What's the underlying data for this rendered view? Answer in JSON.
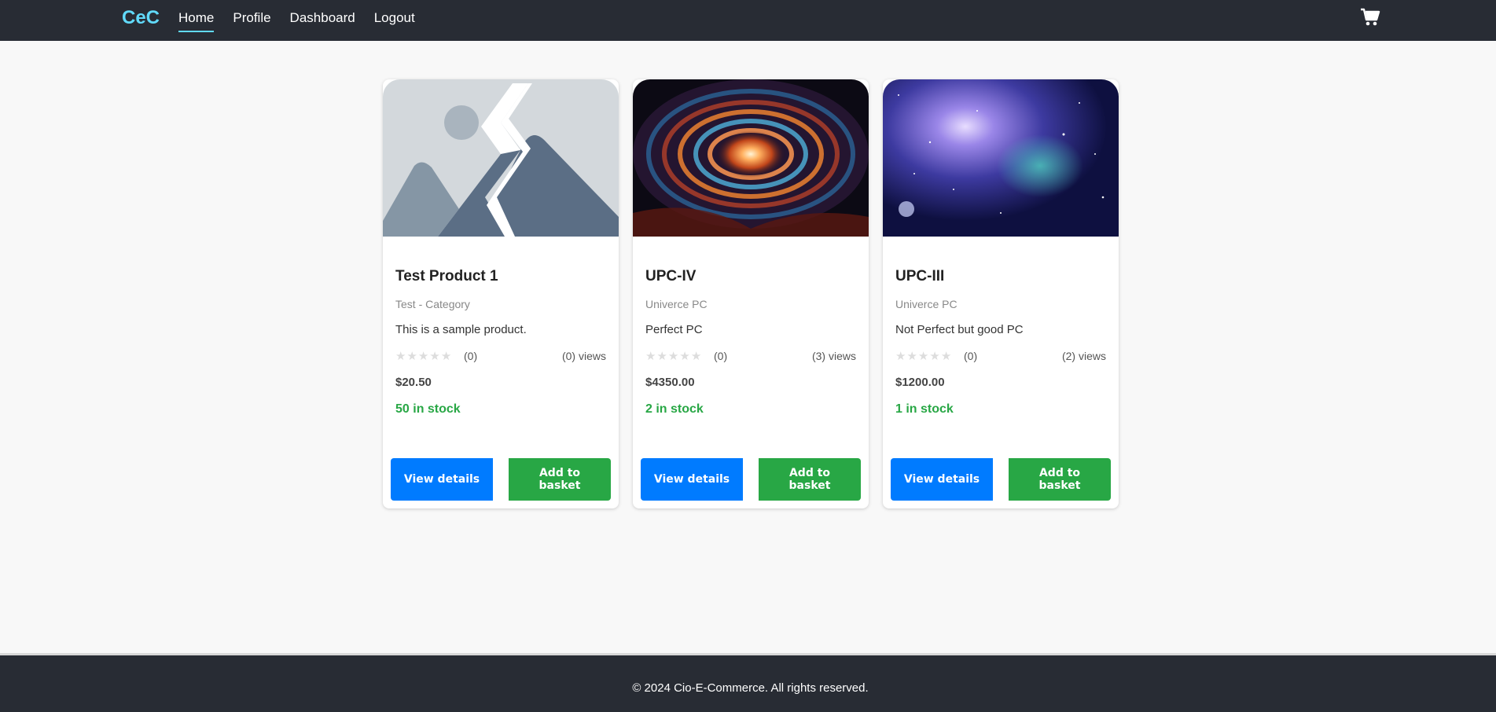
{
  "nav": {
    "brand": "CeC",
    "links": [
      {
        "label": "Home",
        "active": true
      },
      {
        "label": "Profile",
        "active": false
      },
      {
        "label": "Dashboard",
        "active": false
      },
      {
        "label": "Logout",
        "active": false
      }
    ],
    "cart_icon": "shopping-cart-icon"
  },
  "products": [
    {
      "title": "Test Product 1",
      "category": "Test - Category",
      "description": "This is a sample product.",
      "rating_count": "(0)",
      "views": "(0) views",
      "price": "$20.50",
      "stock": "50 in stock",
      "image": "placeholder-image",
      "view_label": "View details",
      "add_label": "Add to basket"
    },
    {
      "title": "UPC-IV",
      "category": "Univerce PC",
      "description": "Perfect PC",
      "rating_count": "(0)",
      "views": "(3) views",
      "price": "$4350.00",
      "stock": "2 in stock",
      "image": "spiral-galaxy-image",
      "view_label": "View details",
      "add_label": "Add to basket"
    },
    {
      "title": "UPC-III",
      "category": "Univerce PC",
      "description": "Not Perfect but good PC",
      "rating_count": "(0)",
      "views": "(2) views",
      "price": "$1200.00",
      "stock": "1 in stock",
      "image": "nebula-image",
      "view_label": "View details",
      "add_label": "Add to basket"
    }
  ],
  "footer": {
    "text": "© 2024 Cio-E-Commerce. All rights reserved."
  },
  "colors": {
    "nav_bg": "#282c34",
    "brand": "#61dafb",
    "primary": "#007bff",
    "success": "#28a745"
  }
}
